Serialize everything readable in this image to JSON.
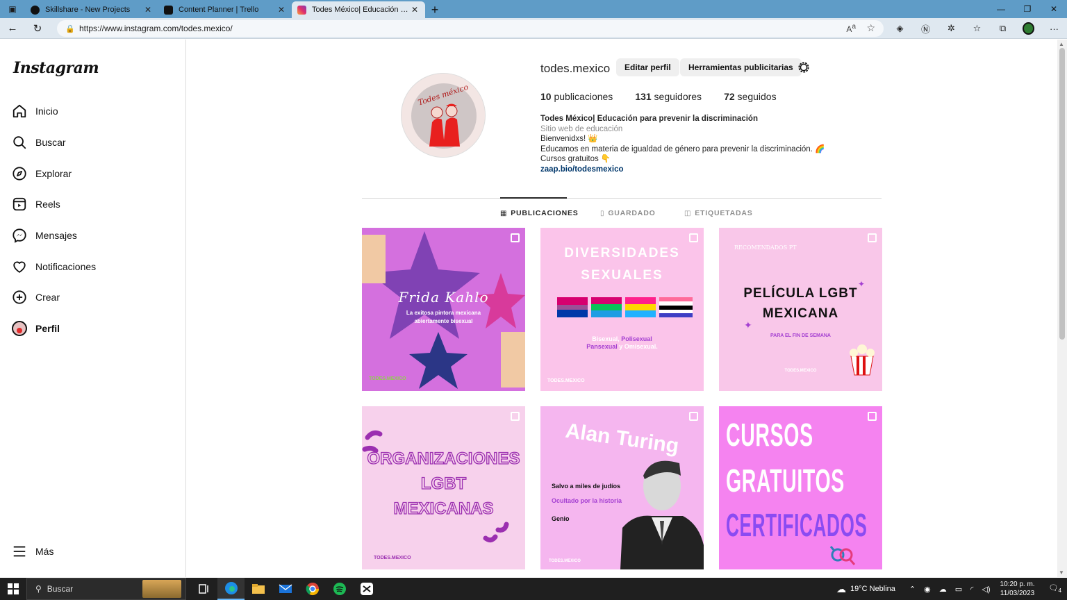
{
  "browser": {
    "tabs": [
      {
        "label": "Skillshare - New Projects",
        "color": "#111111"
      },
      {
        "label": "Content Planner | Trello",
        "color": "#0c66e4"
      },
      {
        "label": "Todes México| Educación para pr",
        "color": "#e1306c"
      }
    ],
    "url": "https://www.instagram.com/todes.mexico/"
  },
  "sidebar": {
    "logo": "Instagram",
    "items": [
      {
        "label": "Inicio",
        "icon": "home-icon"
      },
      {
        "label": "Buscar",
        "icon": "search-icon"
      },
      {
        "label": "Explorar",
        "icon": "compass-icon"
      },
      {
        "label": "Reels",
        "icon": "reels-icon"
      },
      {
        "label": "Mensajes",
        "icon": "messenger-icon"
      },
      {
        "label": "Notificaciones",
        "icon": "heart-icon"
      },
      {
        "label": "Crear",
        "icon": "plus-square-icon"
      },
      {
        "label": "Perfil",
        "icon": "avatar"
      }
    ],
    "more": "Más"
  },
  "profile": {
    "username": "todes.mexico",
    "edit_button": "Editar perfil",
    "ads_button": "Herramientas publicitarias",
    "posts_count": "10",
    "posts_label": " publicaciones",
    "followers_count": "131",
    "followers_label": " seguidores",
    "following_count": "72",
    "following_label": " seguidos",
    "pic_text": "Todes méxico",
    "bio": {
      "name": "Todes México| Educación para prevenir la discriminación",
      "category": "Sitio web de educación",
      "line1": "Bienvenidxs! 👑",
      "line2": "Educamos en materia de igualdad de género para prevenir la discriminación. 🌈",
      "line3": "Cursos gratuitos 👇",
      "link": "zaap.bio/todesmexico"
    }
  },
  "profile_tabs": [
    "PUBLICACIONES",
    "GUARDADO",
    "ETIQUETADAS"
  ],
  "posts": [
    {
      "title": "Frida Kahlo",
      "sub1": "La exitosa pintora mexicana",
      "sub2": "abiertamente bisexual",
      "footer": "TODES.MEXICO"
    },
    {
      "title1": "DIVERSIDADES",
      "title2": "SEXUALES",
      "line1a": "Bisexual,",
      "line1b": " Polisexual",
      "line2a": "Pansexual",
      "line2b": " y Omisexual.",
      "footer": "TODES.MEXICO"
    },
    {
      "kicker": "RECOMENDADOS PT",
      "title1": "PELÍCULA LGBT",
      "title2": "MEXICANA",
      "sub": "PARA EL FIN DE SEMANA",
      "footer": "TODES.MEXICO"
    },
    {
      "title1": "ORGANIZACIONES",
      "title2": "LGBT",
      "title3": "MEXICANAS",
      "footer": "TODES.MEXICO"
    },
    {
      "title": "Alan Turing",
      "line1": "Salvo a miles de judíos",
      "line2": "Ocultado por la historia",
      "line3": "Genio",
      "footer": "TODES.MEXICO"
    },
    {
      "title1": "CURSOS",
      "title2": "GRATUITOS",
      "title3": "CERTIFICADOS"
    }
  ],
  "taskbar": {
    "search": "Buscar",
    "weather": "19°C  Neblina",
    "time": "10:20 p. m.",
    "date": "11/03/2023",
    "notif": "4"
  }
}
